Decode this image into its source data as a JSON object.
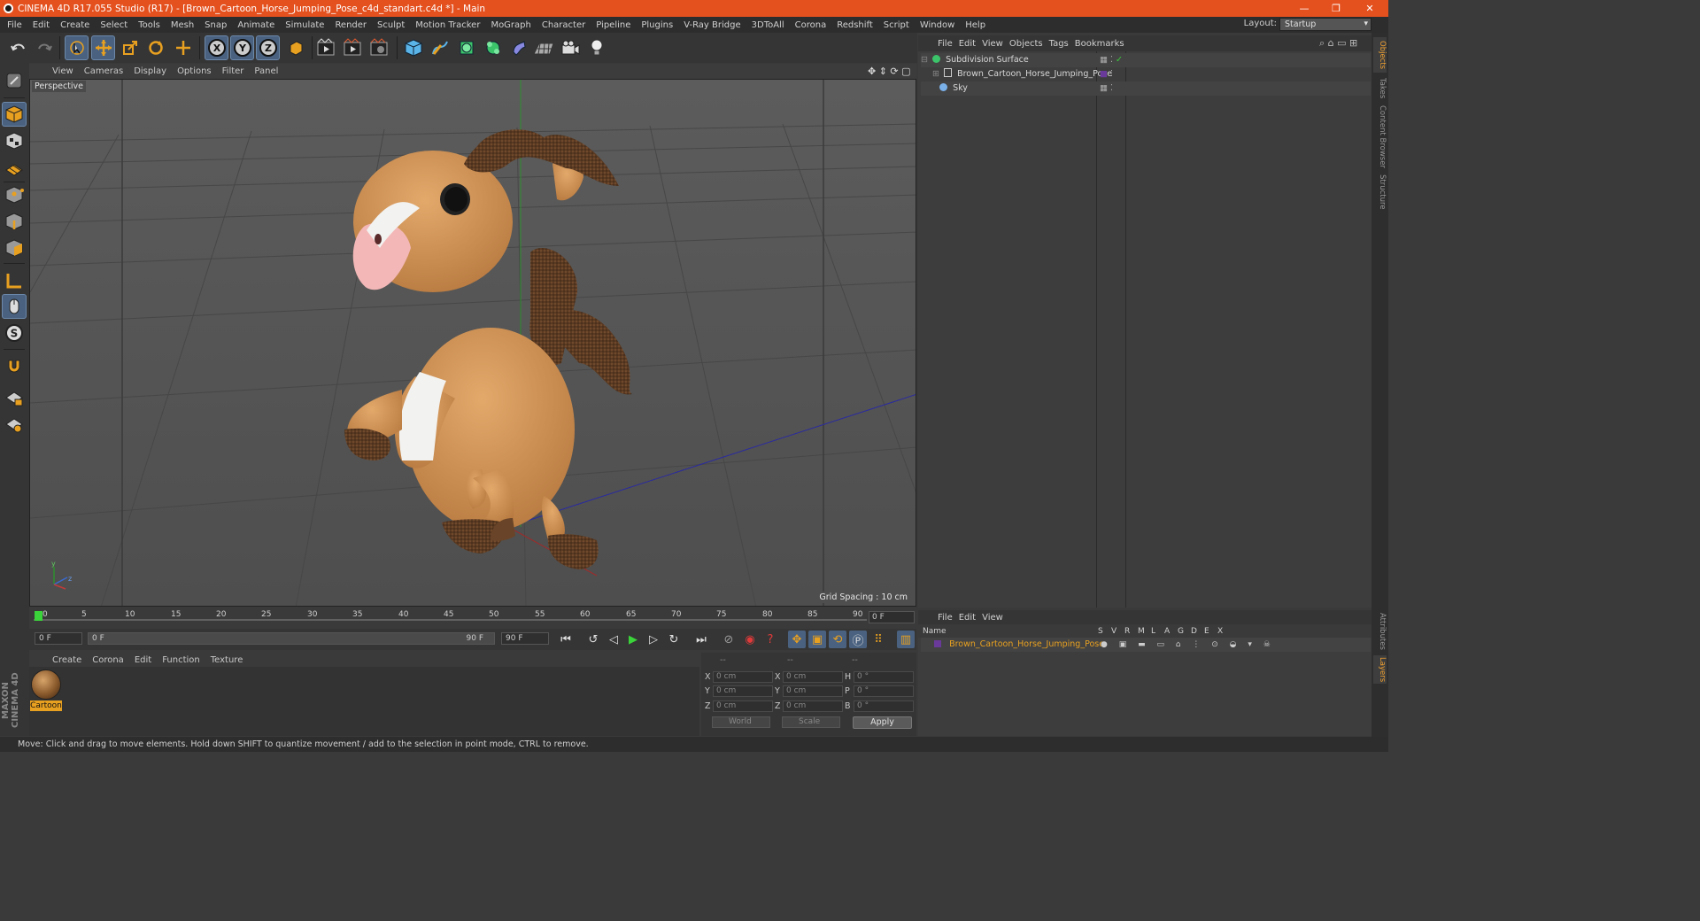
{
  "window": {
    "title": "CINEMA 4D R17.055 Studio (R17) - [Brown_Cartoon_Horse_Jumping_Pose_c4d_standart.c4d *] - Main",
    "minimize": "—",
    "restore": "❐",
    "close": "✕"
  },
  "menu": [
    "File",
    "Edit",
    "Create",
    "Select",
    "Tools",
    "Mesh",
    "Snap",
    "Animate",
    "Simulate",
    "Render",
    "Sculpt",
    "Motion Tracker",
    "MoGraph",
    "Character",
    "Pipeline",
    "Plugins",
    "V-Ray Bridge",
    "3DToAll",
    "Corona",
    "Redshift",
    "Script",
    "Window",
    "Help"
  ],
  "layout": {
    "label": "Layout:",
    "value": "Startup"
  },
  "toolbar": {
    "x_label": "X",
    "y_label": "Y",
    "z_label": "Z"
  },
  "viewport": {
    "menu": [
      "View",
      "Cameras",
      "Display",
      "Options",
      "Filter",
      "Panel"
    ],
    "label": "Perspective",
    "grid_spacing": "Grid Spacing : 10 cm",
    "axis_y": "y",
    "axis_z": "z"
  },
  "timeline": {
    "ticks": [
      "0",
      "5",
      "10",
      "15",
      "20",
      "25",
      "30",
      "35",
      "40",
      "45",
      "50",
      "55",
      "60",
      "65",
      "70",
      "75",
      "80",
      "85",
      "90"
    ],
    "current": "0 F",
    "start": "0 F",
    "range_start": "0 F",
    "range_end": "90 F",
    "end": "90 F"
  },
  "material_manager": {
    "menu": [
      "Create",
      "Corona",
      "Edit",
      "Function",
      "Texture"
    ],
    "materials": [
      {
        "name": "Cartoon"
      }
    ]
  },
  "coordinates": {
    "headers": [
      "--",
      "--",
      "--"
    ],
    "rows": [
      {
        "a": "X",
        "av": "0 cm",
        "b": "X",
        "bv": "0 cm",
        "c": "H",
        "cv": "0 °"
      },
      {
        "a": "Y",
        "av": "0 cm",
        "b": "Y",
        "bv": "0 cm",
        "c": "P",
        "cv": "0 °"
      },
      {
        "a": "Z",
        "av": "0 cm",
        "b": "Z",
        "bv": "0 cm",
        "c": "B",
        "cv": "0 °"
      }
    ],
    "mode": "World",
    "scale": "Scale",
    "apply": "Apply"
  },
  "object_manager": {
    "menu": [
      "File",
      "Edit",
      "View",
      "Objects",
      "Tags",
      "Bookmarks"
    ],
    "objects": [
      {
        "name": "Subdivision Surface"
      },
      {
        "name": "Brown_Cartoon_Horse_Jumping_Pose"
      },
      {
        "name": "Sky"
      }
    ]
  },
  "layer_manager": {
    "menu": [
      "File",
      "Edit",
      "View"
    ],
    "columns": [
      "Name",
      "S",
      "V",
      "R",
      "M",
      "L",
      "A",
      "G",
      "D",
      "E",
      "X"
    ],
    "layers": [
      {
        "name": "Brown_Cartoon_Horse_Jumping_Pose",
        "color": "#e8a020"
      }
    ]
  },
  "side_tabs": [
    "Objects",
    "Takes",
    "Content Browser",
    "Structure"
  ],
  "side_tabs_lower": [
    "Attributes",
    "Layers"
  ],
  "status": "Move: Click and drag to move elements. Hold down SHIFT to quantize movement / add to the selection in point mode, CTRL to remove.",
  "brand": "MAXON CINEMA 4D"
}
